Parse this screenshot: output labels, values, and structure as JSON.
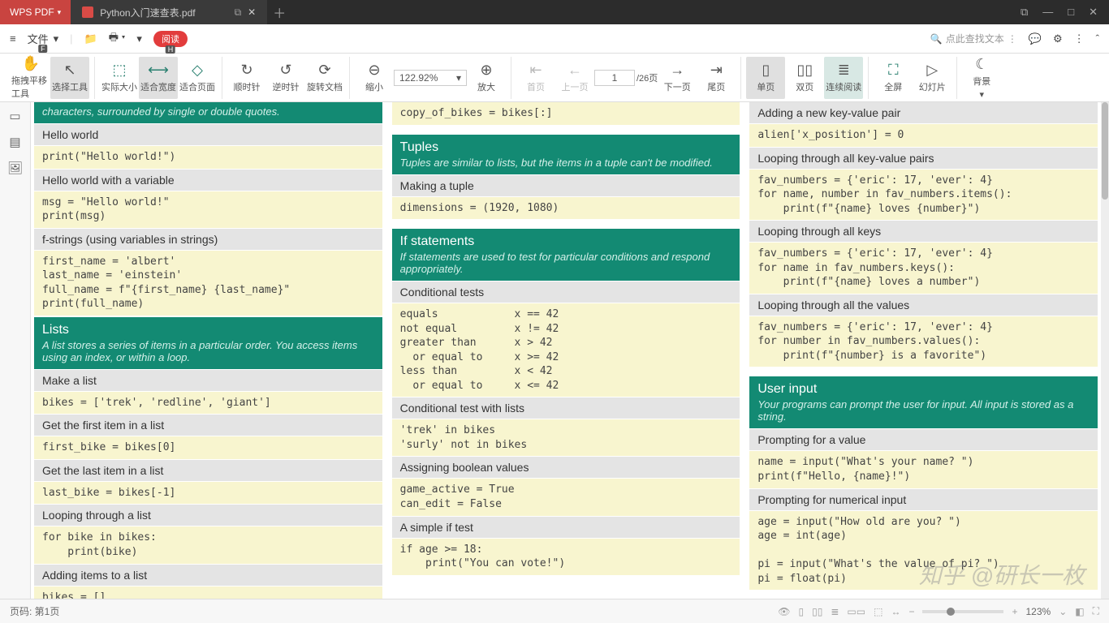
{
  "app": {
    "name": "WPS PDF",
    "file": "Python入门速查表.pdf"
  },
  "menu": {
    "file": "文件",
    "file_key": "F",
    "read": "阅读",
    "read_key": "H",
    "search": "点此查找文本"
  },
  "toolbar": {
    "pan": "拖拽平移工具",
    "select": "选择工具",
    "actual": "实际大小",
    "fitw": "适合宽度",
    "fitp": "适合页面",
    "cw": "顺时针",
    "ccw": "逆时针",
    "rotate": "旋转文档",
    "zoomout": "缩小",
    "zoom": "122.92%",
    "zoomin": "放大",
    "first": "首页",
    "prev": "上一页",
    "page": "1",
    "total": "/26页",
    "next": "下一页",
    "last": "尾页",
    "single": "单页",
    "double": "双页",
    "cont": "连续阅读",
    "full": "全屏",
    "slide": "幻灯片",
    "bg": "背景"
  },
  "status": {
    "page": "页码: 第1页",
    "zoom": "123%"
  },
  "watermark": "知乎 @研长一枚",
  "doc": {
    "c1": {
      "cut": "characters, surrounded by single or double quotes.",
      "hw_t": "Hello world",
      "hw_c": "print(\"Hello world!\")",
      "hwv_t": "Hello world with a variable",
      "hwv_c": "msg = \"Hello world!\"\nprint(msg)",
      "fs_t": "f-strings (using variables in strings)",
      "fs_c": "first_name = 'albert'\nlast_name = 'einstein'\nfull_name = f\"{first_name} {last_name}\"\nprint(full_name)",
      "lists_t": "Lists",
      "lists_d": "A list stores a series of items in a particular order. You access items using an index, or within a loop.",
      "mk_t": "Make a list",
      "mk_c": "bikes = ['trek', 'redline', 'giant']",
      "gf_t": "Get the first item in a list",
      "gf_c": "first_bike = bikes[0]",
      "gl_t": "Get the last item in a list",
      "gl_c": "last_bike = bikes[-1]",
      "lp_t": "Looping through a list",
      "lp_c": "for bike in bikes:\n    print(bike)",
      "ad_t": "Adding items to a list",
      "ad_c": "bikes = []"
    },
    "c2": {
      "cp_c": "copy_of_bikes = bikes[:]",
      "tup_t": "Tuples",
      "tup_d": "Tuples are similar to lists, but the items in a tuple can't be modified.",
      "mt_t": "Making a tuple",
      "mt_c": "dimensions = (1920, 1080)",
      "if_t": "If statements",
      "if_d": "If statements are used to test for particular conditions and respond appropriately.",
      "ct_t": "Conditional tests",
      "ct_c": "equals            x == 42\nnot equal         x != 42\ngreater than      x > 42\n  or equal to     x >= 42\nless than         x < 42\n  or equal to     x <= 42",
      "cl_t": "Conditional test with lists",
      "cl_c": "'trek' in bikes\n'surly' not in bikes",
      "ab_t": "Assigning boolean values",
      "ab_c": "game_active = True\ncan_edit = False",
      "si_t": "A simple if test",
      "si_c": "if age >= 18:\n    print(\"You can vote!\")"
    },
    "c3": {
      "ak_t": "Adding a new key-value pair",
      "ak_c": "alien['x_position'] = 0",
      "kv_t": "Looping through all key-value pairs",
      "kv_c": "fav_numbers = {'eric': 17, 'ever': 4}\nfor name, number in fav_numbers.items():\n    print(f\"{name} loves {number}\")",
      "lk_t": "Looping through all keys",
      "lk_c": "fav_numbers = {'eric': 17, 'ever': 4}\nfor name in fav_numbers.keys():\n    print(f\"{name} loves a number\")",
      "lv_t": "Looping through all the values",
      "lv_c": "fav_numbers = {'eric': 17, 'ever': 4}\nfor number in fav_numbers.values():\n    print(f\"{number} is a favorite\")",
      "ui_t": "User input",
      "ui_d": "Your programs can prompt the user for input. All input is stored as a string.",
      "pv_t": "Prompting for a value",
      "pv_c": "name = input(\"What's your name? \")\nprint(f\"Hello, {name}!\")",
      "pn_t": "Prompting for numerical input",
      "pn_c": "age = input(\"How old are you? \")\nage = int(age)\n\npi = input(\"What's the value of pi? \")\npi = float(pi)"
    }
  }
}
